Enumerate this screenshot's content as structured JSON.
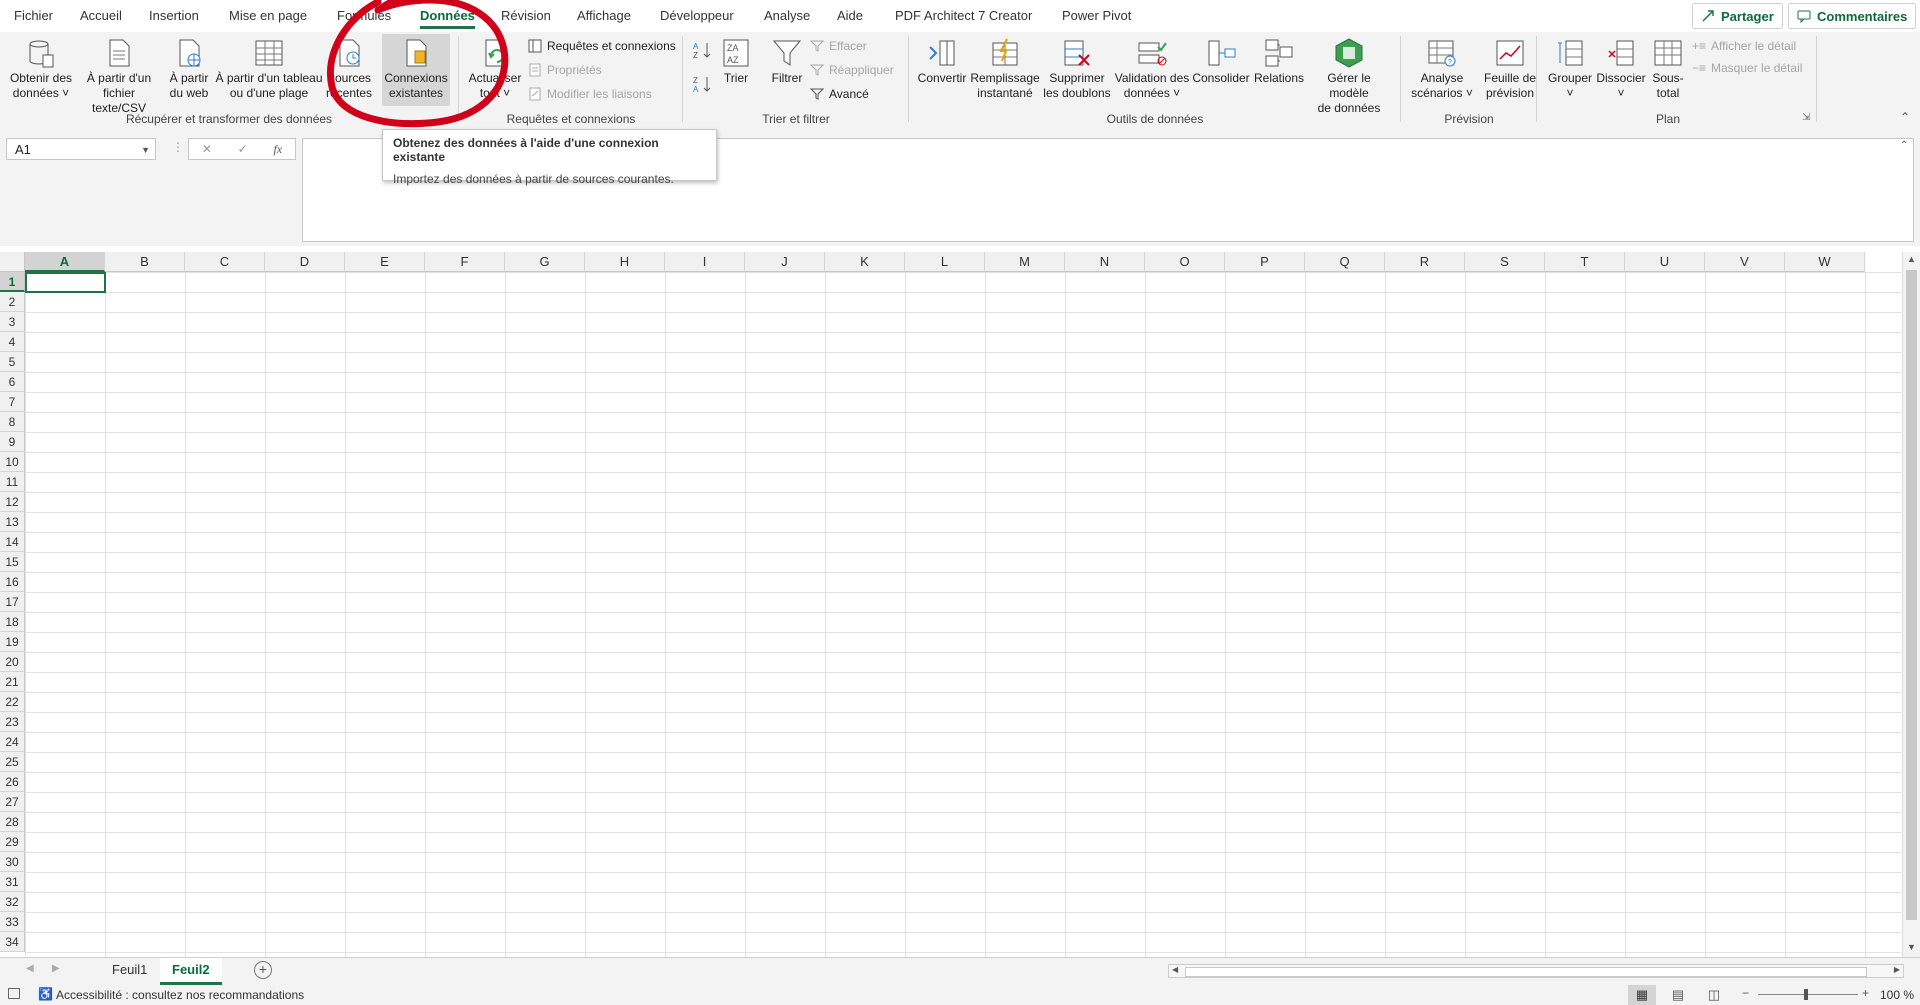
{
  "tabs": [
    "Fichier",
    "Accueil",
    "Insertion",
    "Mise en page",
    "Formules",
    "Données",
    "Révision",
    "Affichage",
    "Développeur",
    "Analyse",
    "Aide",
    "PDF Architect 7 Creator",
    "Power Pivot"
  ],
  "active_tab": "Données",
  "header_buttons": {
    "share": "Partager",
    "comments": "Commentaires"
  },
  "ribbon": {
    "get_transform": {
      "label": "Récupérer et transformer des données",
      "buttons": [
        {
          "l1": "Obtenir des",
          "l2": "données ˅"
        },
        {
          "l1": "À partir d'un",
          "l2": "fichier texte/CSV"
        },
        {
          "l1": "À partir",
          "l2": "du web"
        },
        {
          "l1": "À partir d'un tableau",
          "l2": "ou d'une plage"
        },
        {
          "l1": "Sources",
          "l2": "récentes"
        },
        {
          "l1": "Connexions",
          "l2": "existantes"
        }
      ]
    },
    "queries": {
      "label": "Requêtes et connexions",
      "refresh": {
        "l1": "Actualiser",
        "l2": "tout ˅"
      },
      "items": [
        "Requêtes et connexions",
        "Propriétés",
        "Modifier les liaisons"
      ]
    },
    "sort_filter": {
      "label": "Trier et filtrer",
      "sort": "Trier",
      "filter": "Filtrer",
      "items": [
        "Effacer",
        "Réappliquer",
        "Avancé"
      ]
    },
    "data_tools": {
      "label": "Outils de données",
      "buttons": [
        {
          "l1": "Convertir",
          "l2": ""
        },
        {
          "l1": "Remplissage",
          "l2": "instantané"
        },
        {
          "l1": "Supprimer",
          "l2": "les doublons"
        },
        {
          "l1": "Validation des",
          "l2": "données ˅"
        },
        {
          "l1": "Consolider",
          "l2": ""
        },
        {
          "l1": "Relations",
          "l2": ""
        },
        {
          "l1": "Gérer le modèle",
          "l2": "de données"
        }
      ]
    },
    "forecast": {
      "label": "Prévision",
      "buttons": [
        {
          "l1": "Analyse",
          "l2": "scénarios ˅"
        },
        {
          "l1": "Feuille de",
          "l2": "prévision"
        }
      ]
    },
    "outline": {
      "label": "Plan",
      "buttons": [
        {
          "l1": "Grouper",
          "l2": "˅"
        },
        {
          "l1": "Dissocier",
          "l2": "˅"
        },
        {
          "l1": "Sous-",
          "l2": "total"
        }
      ],
      "items": [
        "Afficher le détail",
        "Masquer le détail"
      ]
    }
  },
  "formula_bar": {
    "name_box": "A1",
    "fx": "fx"
  },
  "tooltip": {
    "title": "Obtenez des données à l'aide d'une connexion existante",
    "body": "Importez des données à partir de sources courantes."
  },
  "columns": [
    "A",
    "B",
    "C",
    "D",
    "E",
    "F",
    "G",
    "H",
    "I",
    "J",
    "K",
    "L",
    "M",
    "N",
    "O",
    "P",
    "Q",
    "R",
    "S",
    "T",
    "U",
    "V",
    "W"
  ],
  "rows": [
    "1",
    "2",
    "3",
    "4",
    "5",
    "6",
    "7",
    "8",
    "9",
    "10",
    "11",
    "12",
    "13",
    "14",
    "15",
    "16",
    "17",
    "18",
    "19",
    "20",
    "21",
    "22",
    "23",
    "24",
    "25",
    "26",
    "27",
    "28",
    "29",
    "30",
    "31",
    "32",
    "33",
    "34"
  ],
  "sheets": [
    "Feuil1",
    "Feuil2"
  ],
  "active_sheet": "Feuil2",
  "status": {
    "accessibility": "Accessibilité : consultez nos recommandations",
    "zoom": "100 %"
  },
  "colors": {
    "accent": "#217346",
    "annotation": "#d0021b"
  }
}
